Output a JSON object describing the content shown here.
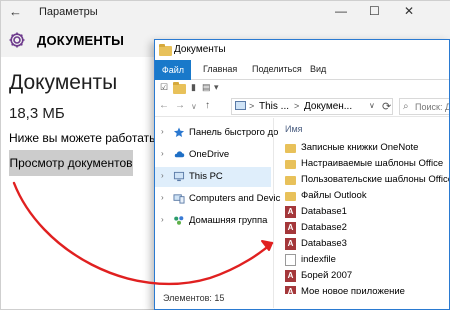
{
  "settings": {
    "window_title": "Параметры",
    "back_glyph": "←",
    "min_glyph": "—",
    "max_glyph": "☐",
    "close_glyph": "✕",
    "section_title": "ДОКУМЕНТЫ",
    "heading": "Документы",
    "size": "18,3 МБ",
    "description": "Ниже вы можете работать с д",
    "view_button": "Просмотр документов"
  },
  "explorer": {
    "title": "Документы",
    "ribbon_tabs": [
      "Файл",
      "Главная",
      "Поделиться",
      "Вид"
    ],
    "nav": {
      "back": "←",
      "forward": "→",
      "dropdown": "∨",
      "up": "↑"
    },
    "address": {
      "crumbs": [
        "This ...",
        "Докумен..."
      ],
      "separator": ">",
      "dropdown": "∨",
      "refresh": "⟳"
    },
    "search_placeholder": "Поиск: Д",
    "tree": [
      {
        "label": "Панель быстрого до",
        "icon": "star-icon"
      },
      {
        "label": "OneDrive",
        "icon": "cloud-icon"
      },
      {
        "label": "This PC",
        "icon": "pc-icon",
        "selected": true
      },
      {
        "label": "Computers and Devic",
        "icon": "devices-icon"
      },
      {
        "label": "Домашняя группа",
        "icon": "homegroup-icon"
      }
    ],
    "column_header": "Имя",
    "files": [
      {
        "name": "Записные книжки OneNote",
        "type": "folder"
      },
      {
        "name": "Настраиваемые шаблоны Office",
        "type": "folder"
      },
      {
        "name": "Пользовательские шаблоны Office",
        "type": "folder"
      },
      {
        "name": "Файлы Outlook",
        "type": "folder"
      },
      {
        "name": "Database1",
        "type": "access"
      },
      {
        "name": "Database2",
        "type": "access"
      },
      {
        "name": "Database3",
        "type": "access"
      },
      {
        "name": "indexfile",
        "type": "file"
      },
      {
        "name": "Борей 2007",
        "type": "access"
      },
      {
        "name": "Мое новое приложение",
        "type": "access"
      }
    ],
    "status": "Элементов: 15"
  },
  "colors": {
    "accent": "#1979ca",
    "arrow": "#e02020",
    "access_icon": "#a4373a",
    "folder": "#e8c15a"
  }
}
